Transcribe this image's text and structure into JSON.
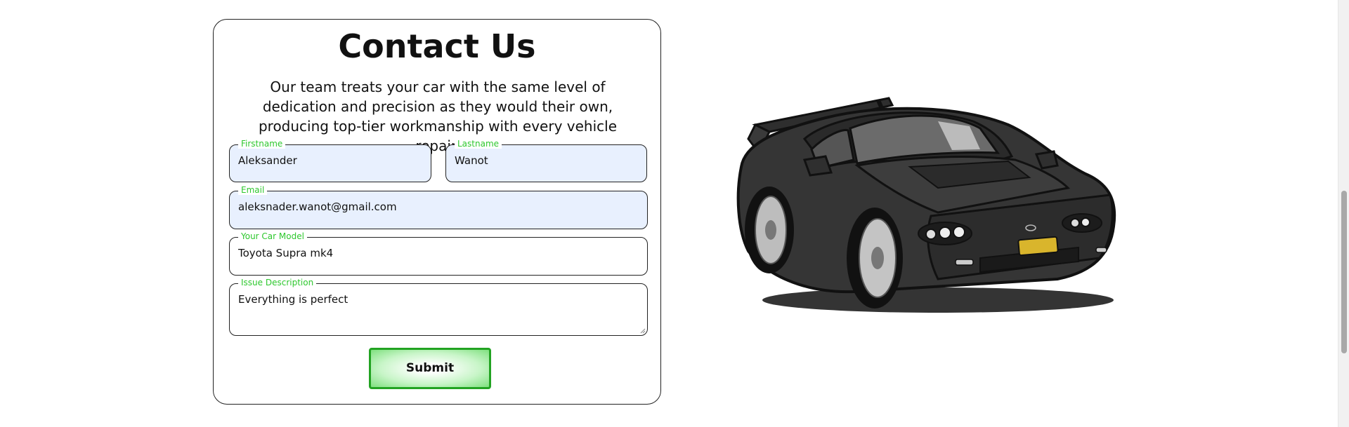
{
  "contact": {
    "title": "Contact Us",
    "description": "Our team treats your car with the same level of dedication and precision as they would their own, producing top-tier workmanship with every vehicle repair.",
    "fields": {
      "firstname": {
        "legend": "Firstname",
        "value": "Aleksander"
      },
      "lastname": {
        "legend": "Lastname",
        "value": "Wanot"
      },
      "email": {
        "legend": "Email",
        "value": "aleksnader.wanot@gmail.com"
      },
      "car_model": {
        "legend": "Your Car Model",
        "value": "Toyota Supra mk4"
      },
      "issue": {
        "legend": "Issue Description",
        "value": "Everything is perfect"
      }
    },
    "submit_label": "Submit"
  },
  "colors": {
    "accent_green": "#2ec82e",
    "button_border": "#22a322",
    "autofill_bg": "#e8f0fe"
  },
  "image": {
    "subject": "black-sports-car-illustration"
  }
}
